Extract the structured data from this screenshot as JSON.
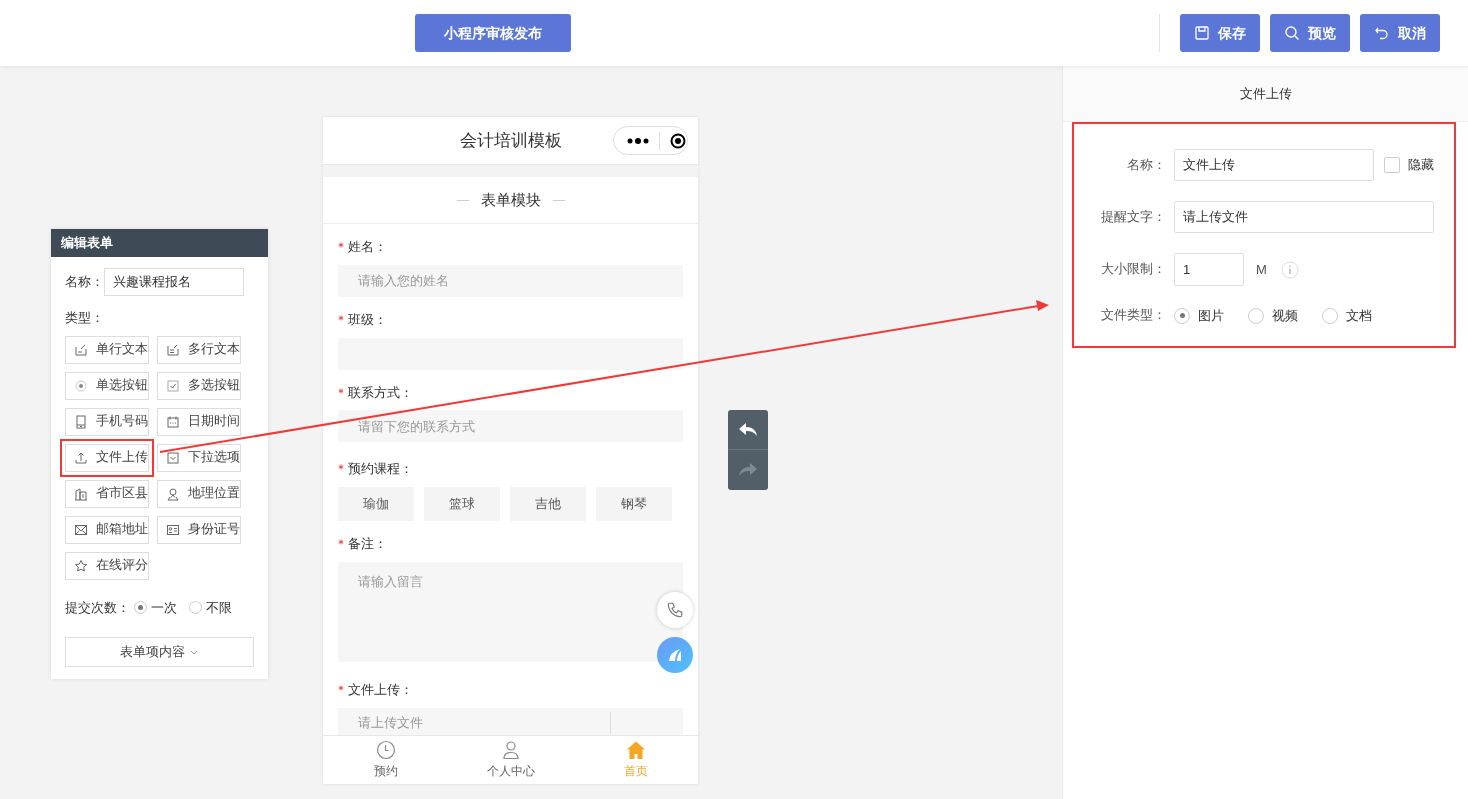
{
  "top_bar": {
    "publish_button": "小程序审核发布",
    "actions": [
      {
        "kind": "save",
        "label": "保存"
      },
      {
        "kind": "preview",
        "label": "预览"
      },
      {
        "kind": "cancel",
        "label": "取消"
      }
    ]
  },
  "form_editor": {
    "title": "编辑表单",
    "name_label": "名称：",
    "name_value": "兴趣课程报名",
    "type_label": "类型：",
    "types": [
      {
        "kind": "single_text",
        "label": "单行文本",
        "annotated": false
      },
      {
        "kind": "multi_text",
        "label": "多行文本",
        "annotated": false
      },
      {
        "kind": "radio",
        "label": "单选按钮",
        "annotated": false
      },
      {
        "kind": "checkbox",
        "label": "多选按钮",
        "annotated": false
      },
      {
        "kind": "mobile",
        "label": "手机号码",
        "annotated": false
      },
      {
        "kind": "datetime",
        "label": "日期时间",
        "annotated": false
      },
      {
        "kind": "upload",
        "label": "文件上传",
        "annotated": true
      },
      {
        "kind": "dropdown",
        "label": "下拉选项",
        "annotated": false
      },
      {
        "kind": "region",
        "label": "省市区县",
        "annotated": false
      },
      {
        "kind": "location",
        "label": "地理位置",
        "annotated": false
      },
      {
        "kind": "email",
        "label": "邮箱地址",
        "annotated": false
      },
      {
        "kind": "idcard",
        "label": "身份证号",
        "annotated": false
      },
      {
        "kind": "rating",
        "label": "在线评分",
        "annotated": false
      }
    ],
    "submit_label": "提交次数：",
    "submit_options": [
      {
        "label": "一次",
        "selected": true
      },
      {
        "label": "不限",
        "selected": false
      }
    ],
    "content_button": "表单项内容"
  },
  "phone": {
    "title": "会计培训模板",
    "section_title": "表单模块",
    "fields": [
      {
        "kind": "input",
        "label": "姓名：",
        "required": true,
        "placeholder": "请输入您的姓名"
      },
      {
        "kind": "input",
        "label": "班级：",
        "required": true
      },
      {
        "kind": "input",
        "label": "联系方式：",
        "required": true,
        "placeholder": "请留下您的联系方式"
      },
      {
        "kind": "choices",
        "label": "预约课程：",
        "required": true,
        "options": [
          "瑜伽",
          "篮球",
          "吉他",
          "钢琴"
        ]
      },
      {
        "kind": "textarea",
        "label": "备注：",
        "required": true,
        "placeholder": "请输入留言"
      },
      {
        "kind": "file",
        "label": "文件上传：",
        "required": true,
        "placeholder": "请上传文件"
      }
    ],
    "tabs": [
      {
        "kind": "clock",
        "label": "预约",
        "selected": false
      },
      {
        "kind": "person",
        "label": "个人中心",
        "selected": false
      },
      {
        "kind": "home",
        "label": "首页",
        "selected": true
      }
    ]
  },
  "history": {
    "undo": {
      "disabled": false
    },
    "redo": {
      "disabled": true
    }
  },
  "properties": {
    "title": "文件上传",
    "annotated": true,
    "name_label": "名称：",
    "name_value": "文件上传",
    "hide": {
      "label": "隐藏",
      "checked": false
    },
    "hint_label": "提醒文字：",
    "reminder_text_value": "请上传文件",
    "size_label": "大小限制：",
    "size_value": "1",
    "size_unit": "M",
    "type_label": "文件类型：",
    "file_types": [
      {
        "label": "图片",
        "selected": true
      },
      {
        "label": "视频",
        "selected": false
      },
      {
        "label": "文档",
        "selected": false
      }
    ]
  },
  "annotation": {
    "arrow": true
  }
}
